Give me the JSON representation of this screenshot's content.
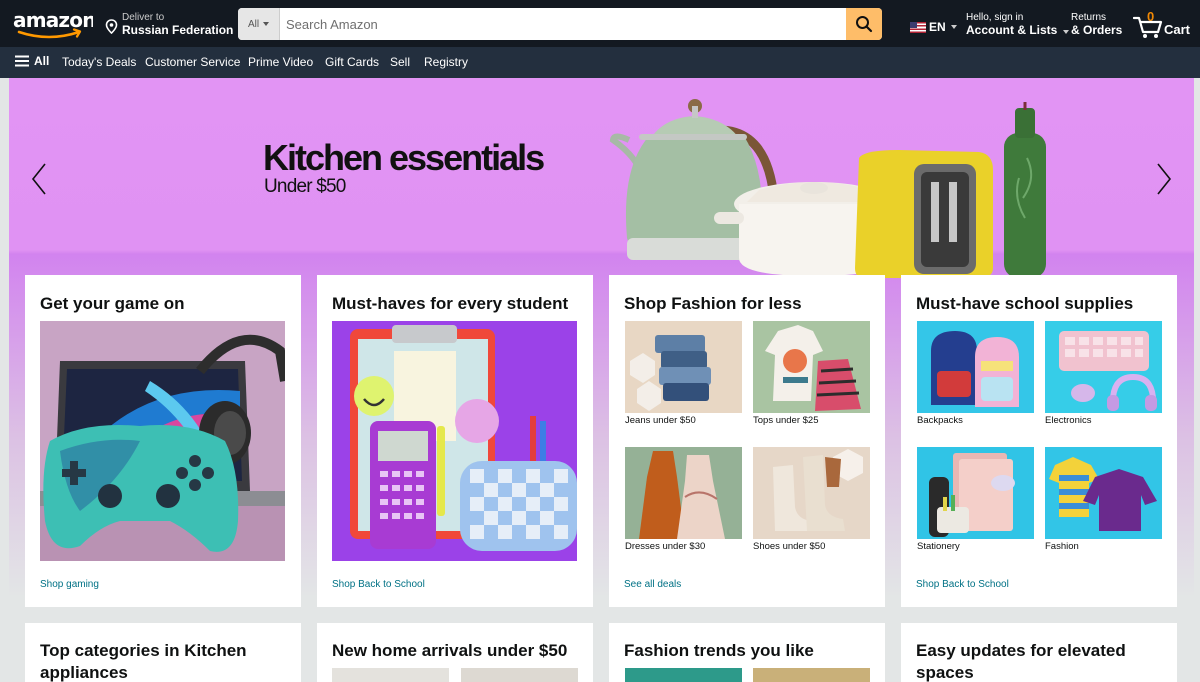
{
  "header": {
    "deliver_line1": "Deliver to",
    "deliver_line2": "Russian Federation",
    "search_category": "All",
    "search_placeholder": "Search Amazon",
    "language": "EN",
    "account_line1": "Hello, sign in",
    "account_line2": "Account & Lists",
    "returns_line1": "Returns",
    "returns_line2": "& Orders",
    "cart_count": "0",
    "cart_label": "Cart"
  },
  "subnav": {
    "all_label": "All",
    "items": [
      "Today's Deals",
      "Customer Service",
      "Prime Video",
      "Gift Cards",
      "Sell",
      "Registry"
    ]
  },
  "hero": {
    "title": "Kitchen essentials",
    "subtitle": "Under $50"
  },
  "cards": [
    {
      "title": "Get your game on",
      "link": "Shop gaming"
    },
    {
      "title": "Must-haves for every student",
      "link": "Shop Back to School"
    },
    {
      "title": "Shop Fashion for less",
      "link": "See all deals",
      "items": [
        "Jeans under $50",
        "Tops under $25",
        "Dresses under $30",
        "Shoes under $50"
      ]
    },
    {
      "title": "Must-have school supplies",
      "link": "Shop Back to School",
      "items": [
        "Backpacks",
        "Electronics",
        "Stationery",
        "Fashion"
      ]
    }
  ],
  "cards_row2": [
    {
      "title": "Top categories in Kitchen appliances"
    },
    {
      "title": "New home arrivals under $50"
    },
    {
      "title": "Fashion trends you like"
    },
    {
      "title": "Easy updates for elevated spaces"
    }
  ],
  "colors": {
    "nav_dark": "#131921",
    "nav_sub": "#232f3e",
    "search_button": "#febd69",
    "hero_purple": "#e294f4",
    "link": "#007185",
    "cart_count": "#f08804"
  }
}
